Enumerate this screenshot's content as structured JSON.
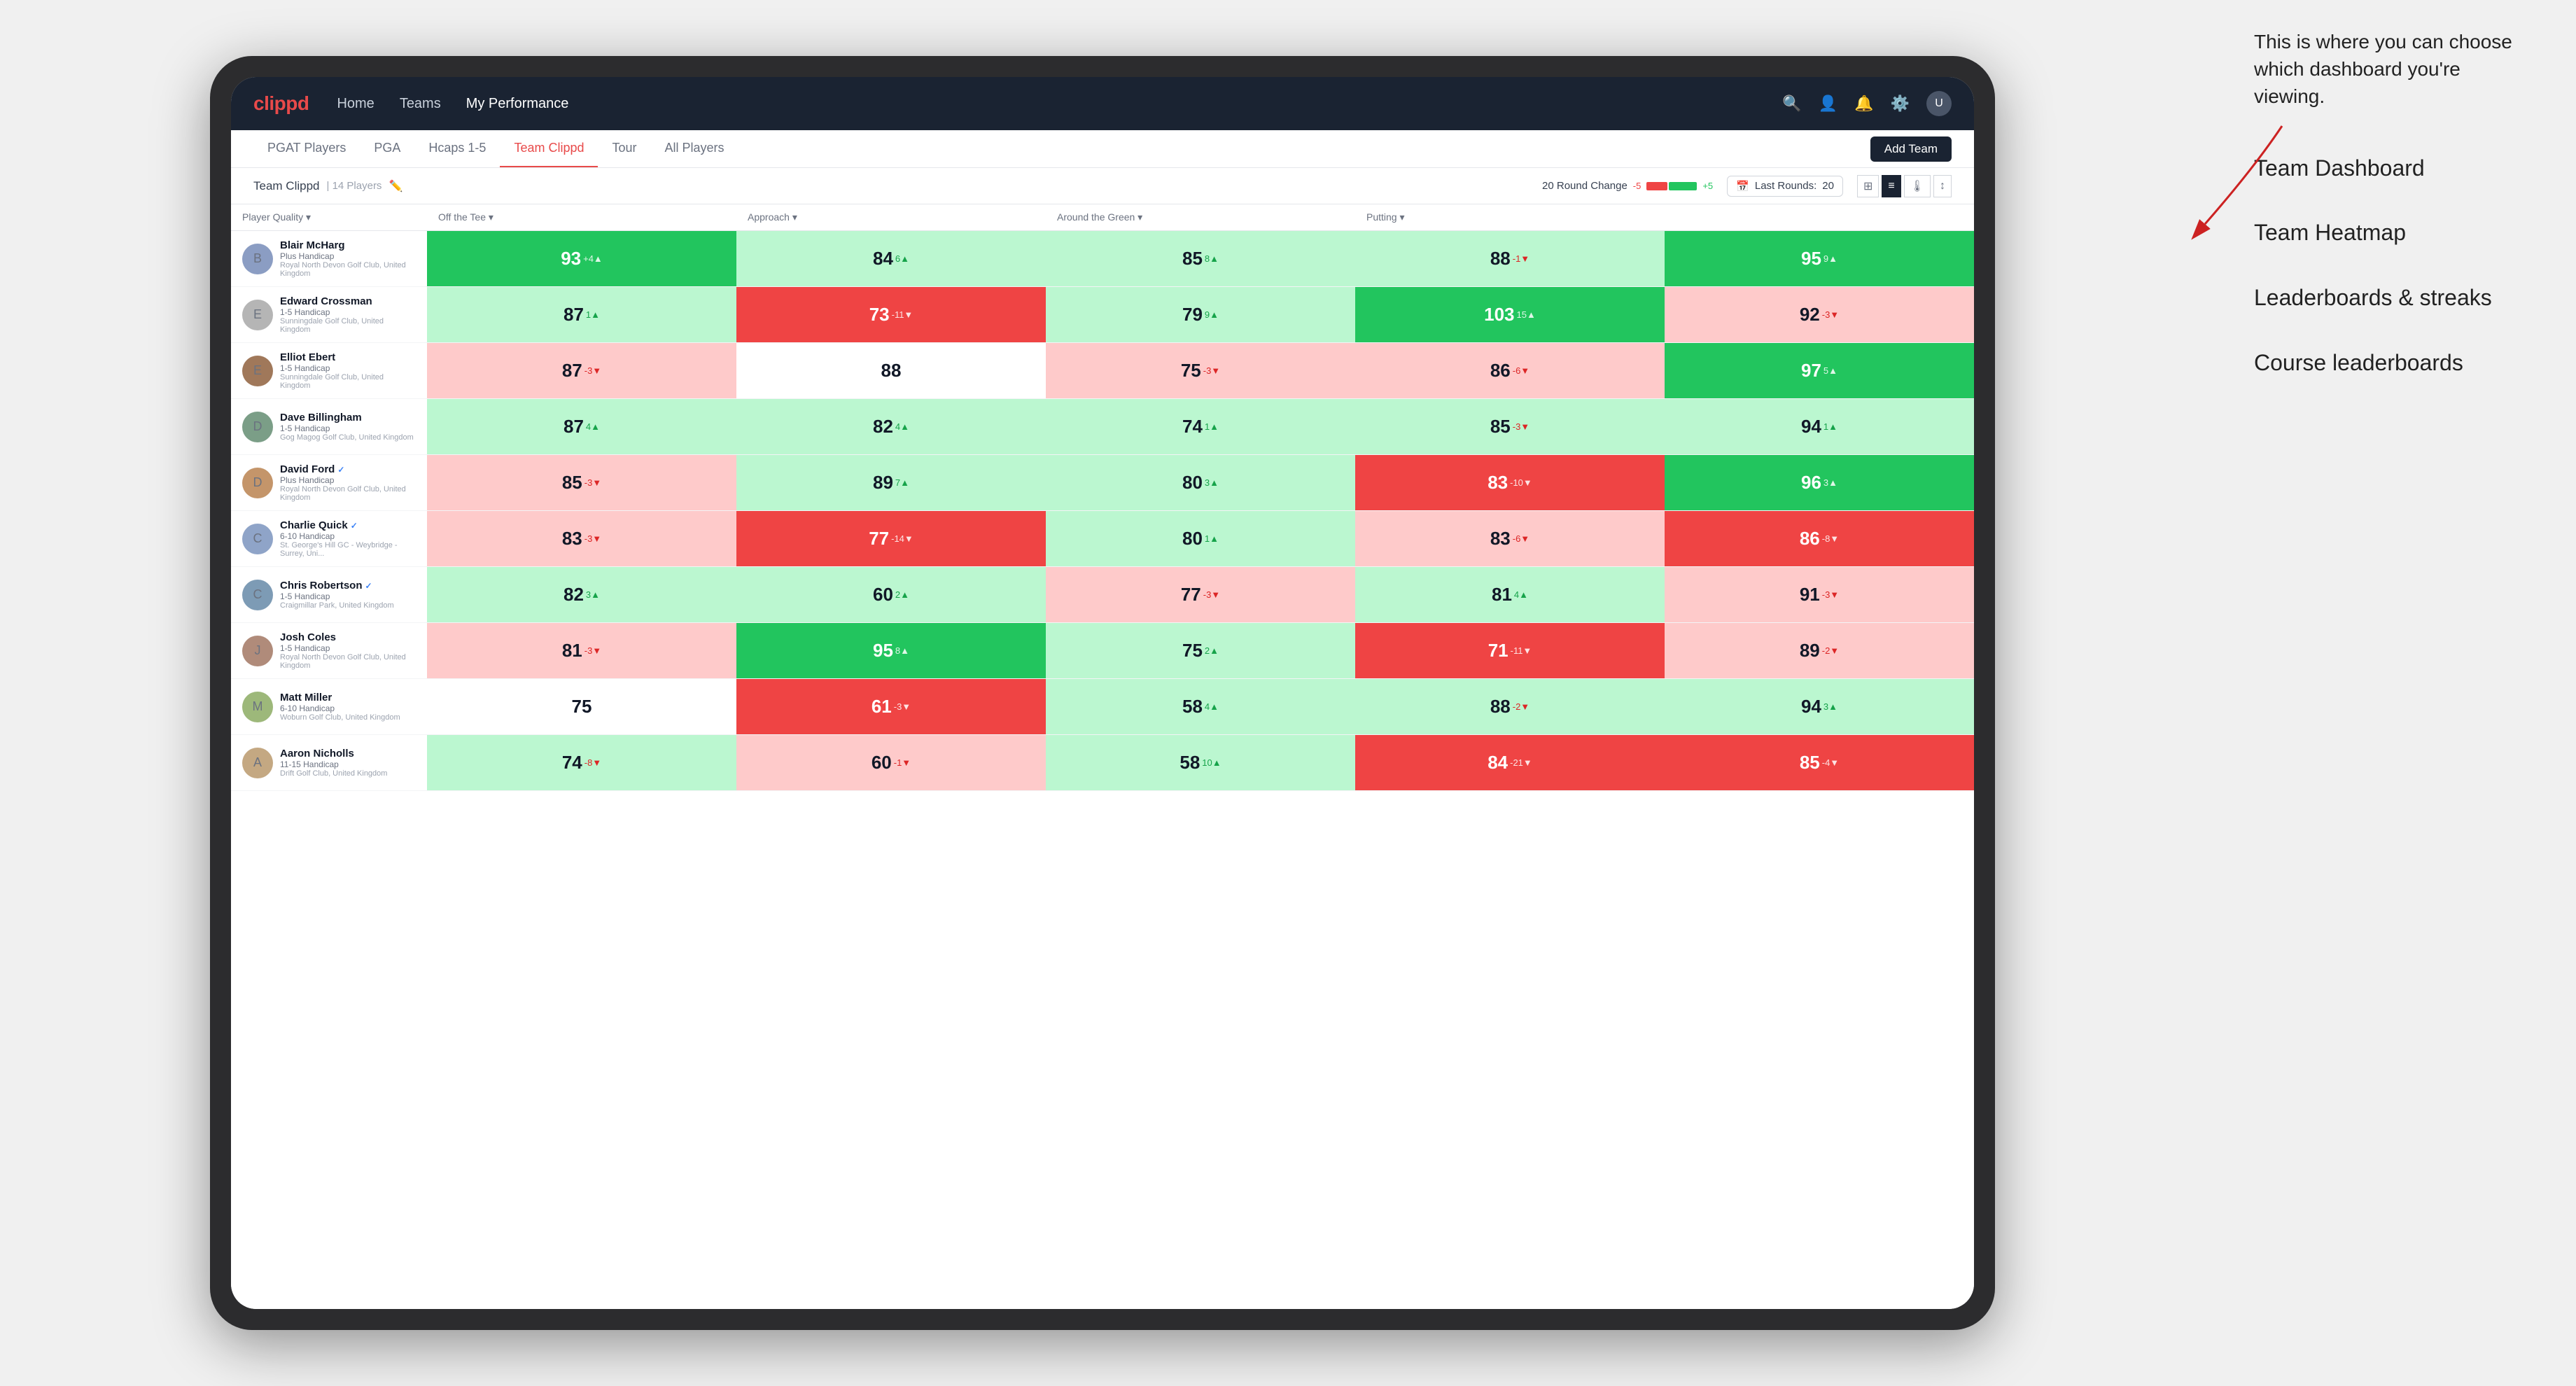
{
  "annotation": {
    "intro": "This is where you can choose which dashboard you're viewing.",
    "items": [
      "Team Dashboard",
      "Team Heatmap",
      "Leaderboards & streaks",
      "Course leaderboards"
    ]
  },
  "navbar": {
    "logo": "clippd",
    "items": [
      "Home",
      "Teams",
      "My Performance"
    ],
    "active_item": "My Performance"
  },
  "subnav": {
    "tabs": [
      "PGAT Players",
      "PGA",
      "Hcaps 1-5",
      "Team Clippd",
      "Tour",
      "All Players"
    ],
    "active_tab": "Team Clippd",
    "add_team_label": "Add Team"
  },
  "team_bar": {
    "team_name": "Team Clippd",
    "separator": "|",
    "player_count": "14 Players",
    "round_change_label": "20 Round Change",
    "change_neg": "-5",
    "change_pos": "+5",
    "last_rounds_label": "Last Rounds:",
    "last_rounds_value": "20"
  },
  "table": {
    "columns": [
      "Player Quality ▾",
      "Off the Tee ▾",
      "Approach ▾",
      "Around the Green ▾",
      "Putting ▾"
    ],
    "rows": [
      {
        "name": "Blair McHarg",
        "handicap": "Plus Handicap",
        "club": "Royal North Devon Golf Club, United Kingdom",
        "verified": false,
        "scores": [
          {
            "value": 93,
            "change": "+4",
            "dir": "up",
            "bg": "green-dark"
          },
          {
            "value": 84,
            "change": "6",
            "dir": "up",
            "bg": "green-light"
          },
          {
            "value": 85,
            "change": "8",
            "dir": "up",
            "bg": "green-light"
          },
          {
            "value": 88,
            "change": "-1",
            "dir": "down",
            "bg": "green-light"
          },
          {
            "value": 95,
            "change": "9",
            "dir": "up",
            "bg": "green-dark"
          }
        ]
      },
      {
        "name": "Edward Crossman",
        "handicap": "1-5 Handicap",
        "club": "Sunningdale Golf Club, United Kingdom",
        "verified": false,
        "scores": [
          {
            "value": 87,
            "change": "1",
            "dir": "up",
            "bg": "green-light"
          },
          {
            "value": 73,
            "change": "-11",
            "dir": "down",
            "bg": "red-dark"
          },
          {
            "value": 79,
            "change": "9",
            "dir": "up",
            "bg": "green-light"
          },
          {
            "value": 103,
            "change": "15",
            "dir": "up",
            "bg": "green-dark"
          },
          {
            "value": 92,
            "change": "-3",
            "dir": "down",
            "bg": "red-light"
          }
        ]
      },
      {
        "name": "Elliot Ebert",
        "handicap": "1-5 Handicap",
        "club": "Sunningdale Golf Club, United Kingdom",
        "verified": false,
        "scores": [
          {
            "value": 87,
            "change": "-3",
            "dir": "down",
            "bg": "red-light"
          },
          {
            "value": 88,
            "change": "",
            "dir": "",
            "bg": "white"
          },
          {
            "value": 75,
            "change": "-3",
            "dir": "down",
            "bg": "red-light"
          },
          {
            "value": 86,
            "change": "-6",
            "dir": "down",
            "bg": "red-light"
          },
          {
            "value": 97,
            "change": "5",
            "dir": "up",
            "bg": "green-dark"
          }
        ]
      },
      {
        "name": "Dave Billingham",
        "handicap": "1-5 Handicap",
        "club": "Gog Magog Golf Club, United Kingdom",
        "verified": false,
        "scores": [
          {
            "value": 87,
            "change": "4",
            "dir": "up",
            "bg": "green-light"
          },
          {
            "value": 82,
            "change": "4",
            "dir": "up",
            "bg": "green-light"
          },
          {
            "value": 74,
            "change": "1",
            "dir": "up",
            "bg": "green-light"
          },
          {
            "value": 85,
            "change": "-3",
            "dir": "down",
            "bg": "green-light"
          },
          {
            "value": 94,
            "change": "1",
            "dir": "up",
            "bg": "green-light"
          }
        ]
      },
      {
        "name": "David Ford",
        "handicap": "Plus Handicap",
        "club": "Royal North Devon Golf Club, United Kingdom",
        "verified": true,
        "scores": [
          {
            "value": 85,
            "change": "-3",
            "dir": "down",
            "bg": "red-light"
          },
          {
            "value": 89,
            "change": "7",
            "dir": "up",
            "bg": "green-light"
          },
          {
            "value": 80,
            "change": "3",
            "dir": "up",
            "bg": "green-light"
          },
          {
            "value": 83,
            "change": "-10",
            "dir": "down",
            "bg": "red-dark"
          },
          {
            "value": 96,
            "change": "3",
            "dir": "up",
            "bg": "green-dark"
          }
        ]
      },
      {
        "name": "Charlie Quick",
        "handicap": "6-10 Handicap",
        "club": "St. George's Hill GC - Weybridge - Surrey, Uni...",
        "verified": true,
        "scores": [
          {
            "value": 83,
            "change": "-3",
            "dir": "down",
            "bg": "red-light"
          },
          {
            "value": 77,
            "change": "-14",
            "dir": "down",
            "bg": "red-dark"
          },
          {
            "value": 80,
            "change": "1",
            "dir": "up",
            "bg": "green-light"
          },
          {
            "value": 83,
            "change": "-6",
            "dir": "down",
            "bg": "red-light"
          },
          {
            "value": 86,
            "change": "-8",
            "dir": "down",
            "bg": "red-dark"
          }
        ]
      },
      {
        "name": "Chris Robertson",
        "handicap": "1-5 Handicap",
        "club": "Craigmillar Park, United Kingdom",
        "verified": true,
        "scores": [
          {
            "value": 82,
            "change": "3",
            "dir": "up",
            "bg": "green-light"
          },
          {
            "value": 60,
            "change": "2",
            "dir": "up",
            "bg": "green-light"
          },
          {
            "value": 77,
            "change": "-3",
            "dir": "down",
            "bg": "red-light"
          },
          {
            "value": 81,
            "change": "4",
            "dir": "up",
            "bg": "green-light"
          },
          {
            "value": 91,
            "change": "-3",
            "dir": "down",
            "bg": "red-light"
          }
        ]
      },
      {
        "name": "Josh Coles",
        "handicap": "1-5 Handicap",
        "club": "Royal North Devon Golf Club, United Kingdom",
        "verified": false,
        "scores": [
          {
            "value": 81,
            "change": "-3",
            "dir": "down",
            "bg": "red-light"
          },
          {
            "value": 95,
            "change": "8",
            "dir": "up",
            "bg": "green-dark"
          },
          {
            "value": 75,
            "change": "2",
            "dir": "up",
            "bg": "green-light"
          },
          {
            "value": 71,
            "change": "-11",
            "dir": "down",
            "bg": "red-dark"
          },
          {
            "value": 89,
            "change": "-2",
            "dir": "down",
            "bg": "red-light"
          }
        ]
      },
      {
        "name": "Matt Miller",
        "handicap": "6-10 Handicap",
        "club": "Woburn Golf Club, United Kingdom",
        "verified": false,
        "scores": [
          {
            "value": 75,
            "change": "",
            "dir": "",
            "bg": "white"
          },
          {
            "value": 61,
            "change": "-3",
            "dir": "down",
            "bg": "red-dark"
          },
          {
            "value": 58,
            "change": "4",
            "dir": "up",
            "bg": "green-light"
          },
          {
            "value": 88,
            "change": "-2",
            "dir": "down",
            "bg": "green-light"
          },
          {
            "value": 94,
            "change": "3",
            "dir": "up",
            "bg": "green-light"
          }
        ]
      },
      {
        "name": "Aaron Nicholls",
        "handicap": "11-15 Handicap",
        "club": "Drift Golf Club, United Kingdom",
        "verified": false,
        "scores": [
          {
            "value": 74,
            "change": "-8",
            "dir": "down",
            "bg": "green-light"
          },
          {
            "value": 60,
            "change": "-1",
            "dir": "down",
            "bg": "red-light"
          },
          {
            "value": 58,
            "change": "10",
            "dir": "up",
            "bg": "green-light"
          },
          {
            "value": 84,
            "change": "-21",
            "dir": "down",
            "bg": "red-dark"
          },
          {
            "value": 85,
            "change": "-4",
            "dir": "down",
            "bg": "red-dark"
          }
        ]
      }
    ]
  }
}
